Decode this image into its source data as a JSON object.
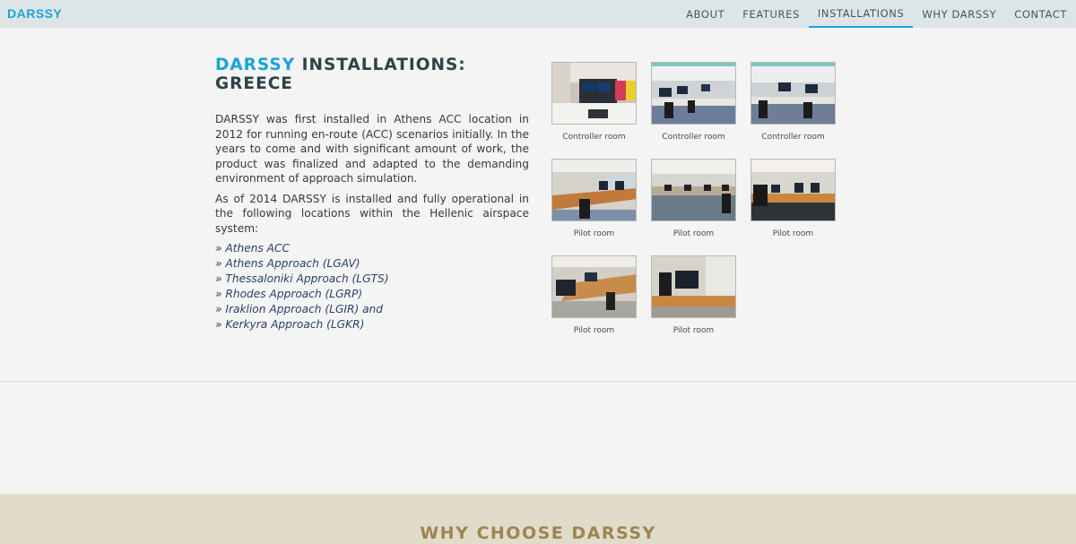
{
  "brand": {
    "name": "DARSSY",
    "color": "#1aa3d9"
  },
  "nav": {
    "items": [
      {
        "label": "ABOUT"
      },
      {
        "label": "FEATURES"
      },
      {
        "label": "INSTALLATIONS",
        "active": true
      },
      {
        "label": "WHY DARSSY"
      },
      {
        "label": "CONTACT"
      }
    ]
  },
  "installations": {
    "title_accent": "DARSSY",
    "title_rest": " INSTALLATIONS: GREECE",
    "paragraph1": "DARSSY was first installed in Athens ACC location in 2012 for running en-route (ACC) scenarios initially. In the years to come and with significant amount of work, the product was finalized and adapted to the demanding environment of approach simulation.",
    "paragraph2": "As of 2014 DARSSY is installed and fully operational in the following locations within the Hellenic airspace system:",
    "locations": [
      "» Athens ACC",
      "» Athens Approach (LGAV)",
      "» Thessaloniki Approach (LGTS)",
      "» Rhodes Approach (LGRP)",
      "» Iraklion Approach (LGIR) and",
      "» Kerkyra Approach (LGKR)"
    ]
  },
  "gallery": [
    {
      "caption": "Controller room",
      "kind": "controller-1"
    },
    {
      "caption": "Controller room",
      "kind": "controller-2"
    },
    {
      "caption": "Controller room",
      "kind": "controller-3"
    },
    {
      "caption": "Pilot room",
      "kind": "pilot-1"
    },
    {
      "caption": "Pilot room",
      "kind": "pilot-2"
    },
    {
      "caption": "Pilot room",
      "kind": "pilot-3"
    },
    {
      "caption": "Pilot room",
      "kind": "pilot-4"
    },
    {
      "caption": "Pilot room",
      "kind": "pilot-5"
    }
  ],
  "why": {
    "title": "WHY CHOOSE DARSSY",
    "color": "#9a8650"
  }
}
